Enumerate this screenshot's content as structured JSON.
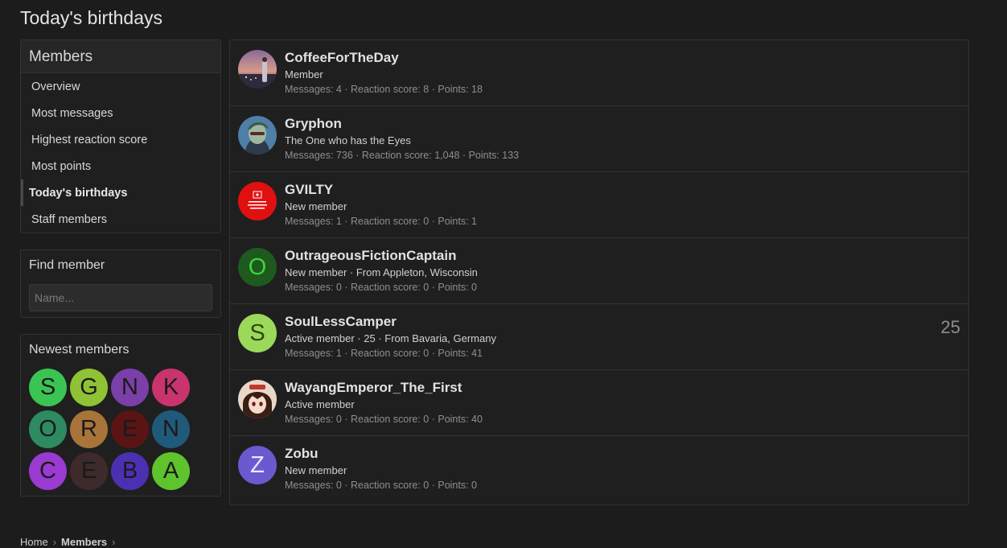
{
  "page": {
    "title": "Today's birthdays"
  },
  "sidebar": {
    "members": {
      "header": "Members",
      "items": [
        {
          "label": "Overview"
        },
        {
          "label": "Most messages"
        },
        {
          "label": "Highest reaction score"
        },
        {
          "label": "Most points"
        },
        {
          "label": "Today's birthdays",
          "selected": true
        },
        {
          "label": "Staff members"
        }
      ]
    },
    "find_member": {
      "header": "Find member",
      "placeholder": "Name..."
    },
    "newest_members": {
      "header": "Newest members",
      "avatars": [
        {
          "letter": "S",
          "color": "#3ac453"
        },
        {
          "letter": "G",
          "color": "#8fc234"
        },
        {
          "letter": "N",
          "color": "#7a3fa8"
        },
        {
          "letter": "K",
          "color": "#c9346e"
        },
        {
          "letter": "O",
          "color": "#2e8a60"
        },
        {
          "letter": "R",
          "color": "#a8743a"
        },
        {
          "letter": "E",
          "color": "#5a1414"
        },
        {
          "letter": "N",
          "color": "#205a7a"
        },
        {
          "letter": "C",
          "color": "#9a3ad1"
        },
        {
          "letter": "E",
          "color": "#3e2a2a"
        },
        {
          "letter": "B",
          "color": "#4c30b2"
        },
        {
          "letter": "A",
          "color": "#5ec32d"
        }
      ]
    }
  },
  "members": [
    {
      "name": "CoffeeForTheDay",
      "title": "Member",
      "stats": "Messages: 4 · Reaction score: 8 · Points: 18",
      "avatar_type": "image",
      "avatar_icon": "landscape-photo-icon"
    },
    {
      "name": "Gryphon",
      "title": "The One who has the Eyes",
      "stats": "Messages: 736 · Reaction score: 1,048 · Points: 133",
      "avatar_type": "image",
      "avatar_icon": "character-portrait-icon"
    },
    {
      "name": "GVILTY",
      "title": "New member",
      "stats": "Messages: 1 · Reaction score: 0 · Points: 1",
      "avatar_type": "image",
      "avatar_icon": "red-logo-icon"
    },
    {
      "name": "OutrageousFictionCaptain",
      "title": "New member · From Appleton, Wisconsin",
      "stats": "Messages: 0 · Reaction score: 0 · Points: 0",
      "avatar_type": "letter",
      "letter": "O",
      "avatar_color": "#1e5a1e",
      "letter_color": "#3ed43e"
    },
    {
      "name": "SoulLessCamper",
      "title": "Active member · 25 · From Bavaria, Germany",
      "stats": "Messages: 1 · Reaction score: 0 · Points: 41",
      "age": "25",
      "avatar_type": "letter",
      "letter": "S",
      "avatar_color": "#9bd95a",
      "letter_color": "#2a4a14"
    },
    {
      "name": "WayangEmperor_The_First",
      "title": "Active member",
      "stats": "Messages: 0 · Reaction score: 0 · Points: 40",
      "avatar_type": "image",
      "avatar_icon": "anime-portrait-icon"
    },
    {
      "name": "Zobu",
      "title": "New member",
      "stats": "Messages: 0 · Reaction score: 0 · Points: 0",
      "avatar_type": "letter",
      "letter": "Z",
      "avatar_color": "#6a5ad0",
      "letter_color": "#e8e8ff"
    }
  ],
  "breadcrumb": [
    {
      "label": "Home"
    },
    {
      "label": "Members"
    }
  ]
}
